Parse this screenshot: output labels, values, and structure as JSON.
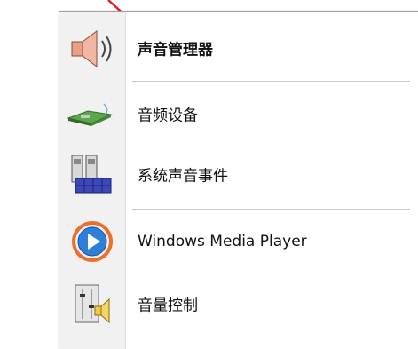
{
  "menu": {
    "items": [
      {
        "label": "声音管理器",
        "icon": "speaker-icon"
      },
      {
        "label": "音频设备",
        "icon": "audio-device-icon"
      },
      {
        "label": "系统声音事件",
        "icon": "system-sounds-icon"
      },
      {
        "label": "Windows Media Player",
        "icon": "media-player-icon"
      },
      {
        "label": "音量控制",
        "icon": "volume-control-icon"
      }
    ]
  },
  "colors": {
    "annotation_arrow": "#e02020",
    "menu_gutter": "#f1f1f1",
    "separator": "#c8c8c8"
  }
}
